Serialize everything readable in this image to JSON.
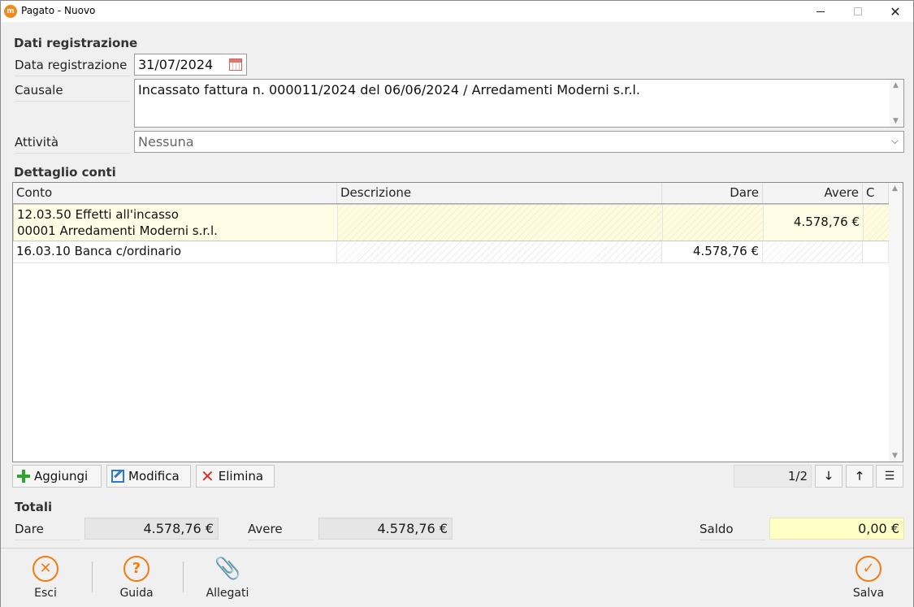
{
  "window": {
    "title": "Pagato - Nuovo",
    "app_icon": "app-logo-icon",
    "minimize_icon": "minimize-icon",
    "maximize_icon": "maximize-icon",
    "close_icon": "close-icon"
  },
  "registrazione": {
    "section_title": "Dati registrazione",
    "data_label": "Data registrazione",
    "data_value": "31/07/2024",
    "causale_label": "Causale",
    "causale_value": "Incassato fattura n. 000011/2024 del 06/06/2024 / Arredamenti Moderni s.r.l.",
    "attivita_label": "Attività",
    "attivita_value": "Nessuna"
  },
  "conti": {
    "section_title": "Dettaglio conti",
    "columns": {
      "conto": "Conto",
      "descrizione": "Descrizione",
      "dare": "Dare",
      "avere": "Avere",
      "c": "C"
    },
    "rows": [
      {
        "conto_line1": "12.03.50 Effetti all'incasso",
        "conto_line2": "00001 Arredamenti Moderni s.r.l.",
        "descrizione": "",
        "dare": "",
        "avere": "4.578,76 €",
        "c": ""
      },
      {
        "conto_line1": "16.03.10 Banca c/ordinario",
        "conto_line2": "",
        "descrizione": "",
        "dare": "4.578,76 €",
        "avere": "",
        "c": ""
      }
    ],
    "buttons": {
      "aggiungi": "Aggiungi",
      "modifica": "Modifica",
      "elimina": "Elimina"
    },
    "pager": "1/2"
  },
  "totali": {
    "section_title": "Totali",
    "dare_label": "Dare",
    "dare_value": "4.578,76 €",
    "avere_label": "Avere",
    "avere_value": "4.578,76 €",
    "saldo_label": "Saldo",
    "saldo_value": "0,00 €"
  },
  "footer": {
    "esci": "Esci",
    "guida": "Guida",
    "allegati": "Allegati",
    "salva": "Salva"
  },
  "colors": {
    "accent": "#f07d12",
    "saldo_bg": "#ffffc6",
    "selected_row_bg": "#fffde6"
  }
}
